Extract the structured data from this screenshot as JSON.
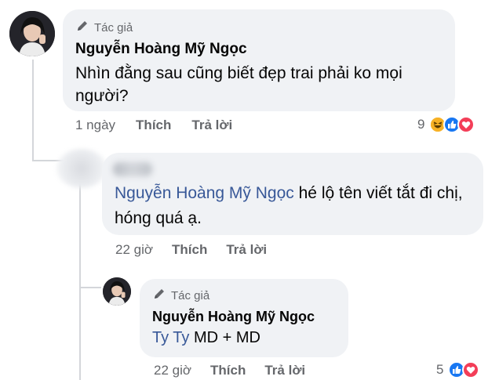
{
  "comment1": {
    "badge": "Tác giả",
    "author": "Nguyễn Hoàng Mỹ Ngọc",
    "text": "Nhìn đằng sau cũng biết đẹp trai phải ko mọi người?",
    "time": "1 ngày",
    "like": "Thích",
    "reply": "Trả lời",
    "reaction_count": "9"
  },
  "comment2": {
    "mention": "Nguyễn Hoàng Mỹ Ngọc",
    "text": " hé lộ tên viết tắt đi chị, hóng quá ạ.",
    "time": "22 giờ",
    "like": "Thích",
    "reply": "Trả lời"
  },
  "comment3": {
    "badge": "Tác giả",
    "author": "Nguyễn Hoàng Mỹ Ngọc",
    "mention": "Ty Ty",
    "text": " MD + MD",
    "time": "22 giờ",
    "like": "Thích",
    "reply": "Trả lời",
    "reaction_count": "5"
  },
  "colors": {
    "bubble": "#f0f2f5",
    "mention": "#385898",
    "like_blue": "#1877f2",
    "love_red": "#f33e58",
    "haha_yellow": "#f7b125"
  },
  "icons": [
    "pencil-icon",
    "haha-reaction-icon",
    "like-reaction-icon",
    "love-reaction-icon"
  ]
}
